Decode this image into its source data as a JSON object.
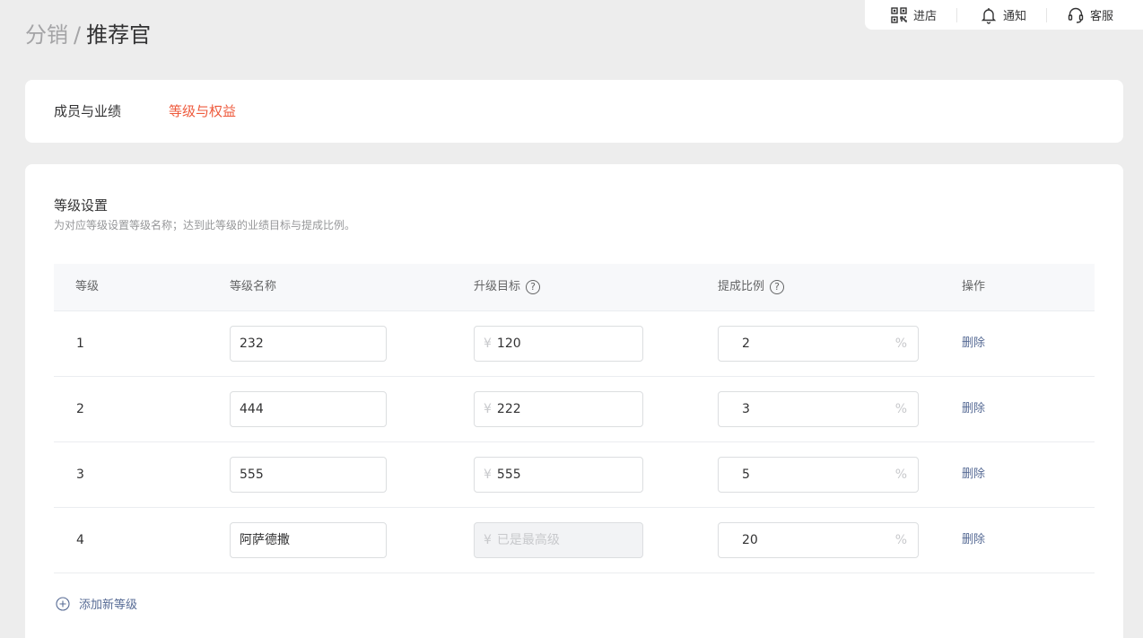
{
  "topbar": {
    "items": [
      {
        "label": "进店",
        "icon": "qrcode-icon"
      },
      {
        "label": "通知",
        "icon": "bell-icon"
      },
      {
        "label": "客服",
        "icon": "headset-icon"
      }
    ]
  },
  "breadcrumb": {
    "parent": "分销",
    "separator": "/",
    "current": "推荐官"
  },
  "tabs": [
    {
      "label": "成员与业绩",
      "active": false
    },
    {
      "label": "等级与权益",
      "active": true
    }
  ],
  "section": {
    "title": "等级设置",
    "description": "为对应等级设置等级名称；达到此等级的业绩目标与提成比例。"
  },
  "table": {
    "headers": {
      "level": "等级",
      "name": "等级名称",
      "target": "升级目标",
      "rate": "提成比例",
      "action": "操作"
    },
    "help_glyph": "?",
    "currency_prefix": "¥",
    "percent_suffix": "%",
    "delete_label": "删除",
    "rows": [
      {
        "level": "1",
        "name": "232",
        "target": "120",
        "rate": "2"
      },
      {
        "level": "2",
        "name": "444",
        "target": "222",
        "rate": "3"
      },
      {
        "level": "3",
        "name": "555",
        "target": "555",
        "rate": "5"
      },
      {
        "level": "4",
        "name": "阿萨德撒",
        "target": "已是最高级",
        "target_disabled": true,
        "rate": "20"
      }
    ]
  },
  "add_level_label": "添加新等级",
  "colors": {
    "accent": "#ee5a3c",
    "link": "#576b95",
    "background": "#ededed"
  }
}
